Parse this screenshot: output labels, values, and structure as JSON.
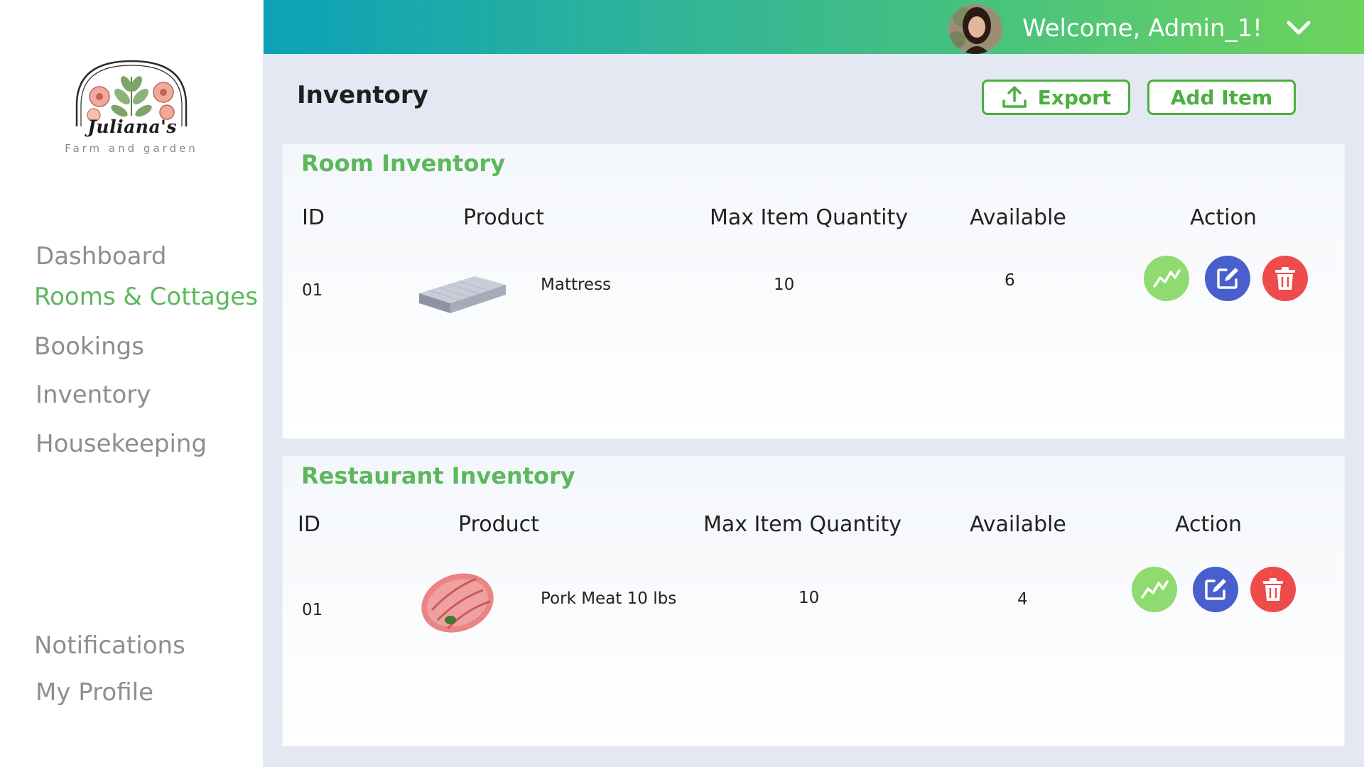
{
  "brand": {
    "script_name": "Juliana's",
    "tagline": "Farm and garden"
  },
  "sidebar": {
    "items": [
      {
        "label": "Dashboard",
        "active": false
      },
      {
        "label": "Rooms & Cottages",
        "active": true
      },
      {
        "label": "Bookings",
        "active": false
      },
      {
        "label": "Inventory",
        "active": false
      },
      {
        "label": "Housekeeping",
        "active": false
      }
    ],
    "bottom_items": [
      {
        "label": "Notifications"
      },
      {
        "label": "My Profile"
      }
    ]
  },
  "header": {
    "welcome": "Welcome, Admin_1!"
  },
  "page": {
    "title": "Inventory",
    "export_label": "Export",
    "add_label": "Add Item"
  },
  "room_inventory": {
    "title": "Room Inventory",
    "columns": [
      "ID",
      "Product",
      "Max Item Quantity",
      "Available",
      "Action"
    ],
    "rows": [
      {
        "id": "01",
        "product": "Mattress",
        "max_qty": "10",
        "available": "6"
      }
    ]
  },
  "restaurant_inventory": {
    "title": "Restaurant Inventory",
    "columns": [
      "ID",
      "Product",
      "Max Item Quantity",
      "Available",
      "Action"
    ],
    "rows": [
      {
        "id": "01",
        "product": "Pork Meat 10 lbs",
        "max_qty": "10",
        "available": "4"
      }
    ]
  },
  "colors": {
    "accent_green": "#5cb85c",
    "button_green": "#4caf3f",
    "action_stats": "#8fdb6f",
    "action_edit": "#4a5fce",
    "action_delete": "#ef4b4b"
  },
  "icons": [
    "chevron-down-icon",
    "upload-icon",
    "trend-chart-icon",
    "edit-icon",
    "trash-icon",
    "avatar"
  ]
}
